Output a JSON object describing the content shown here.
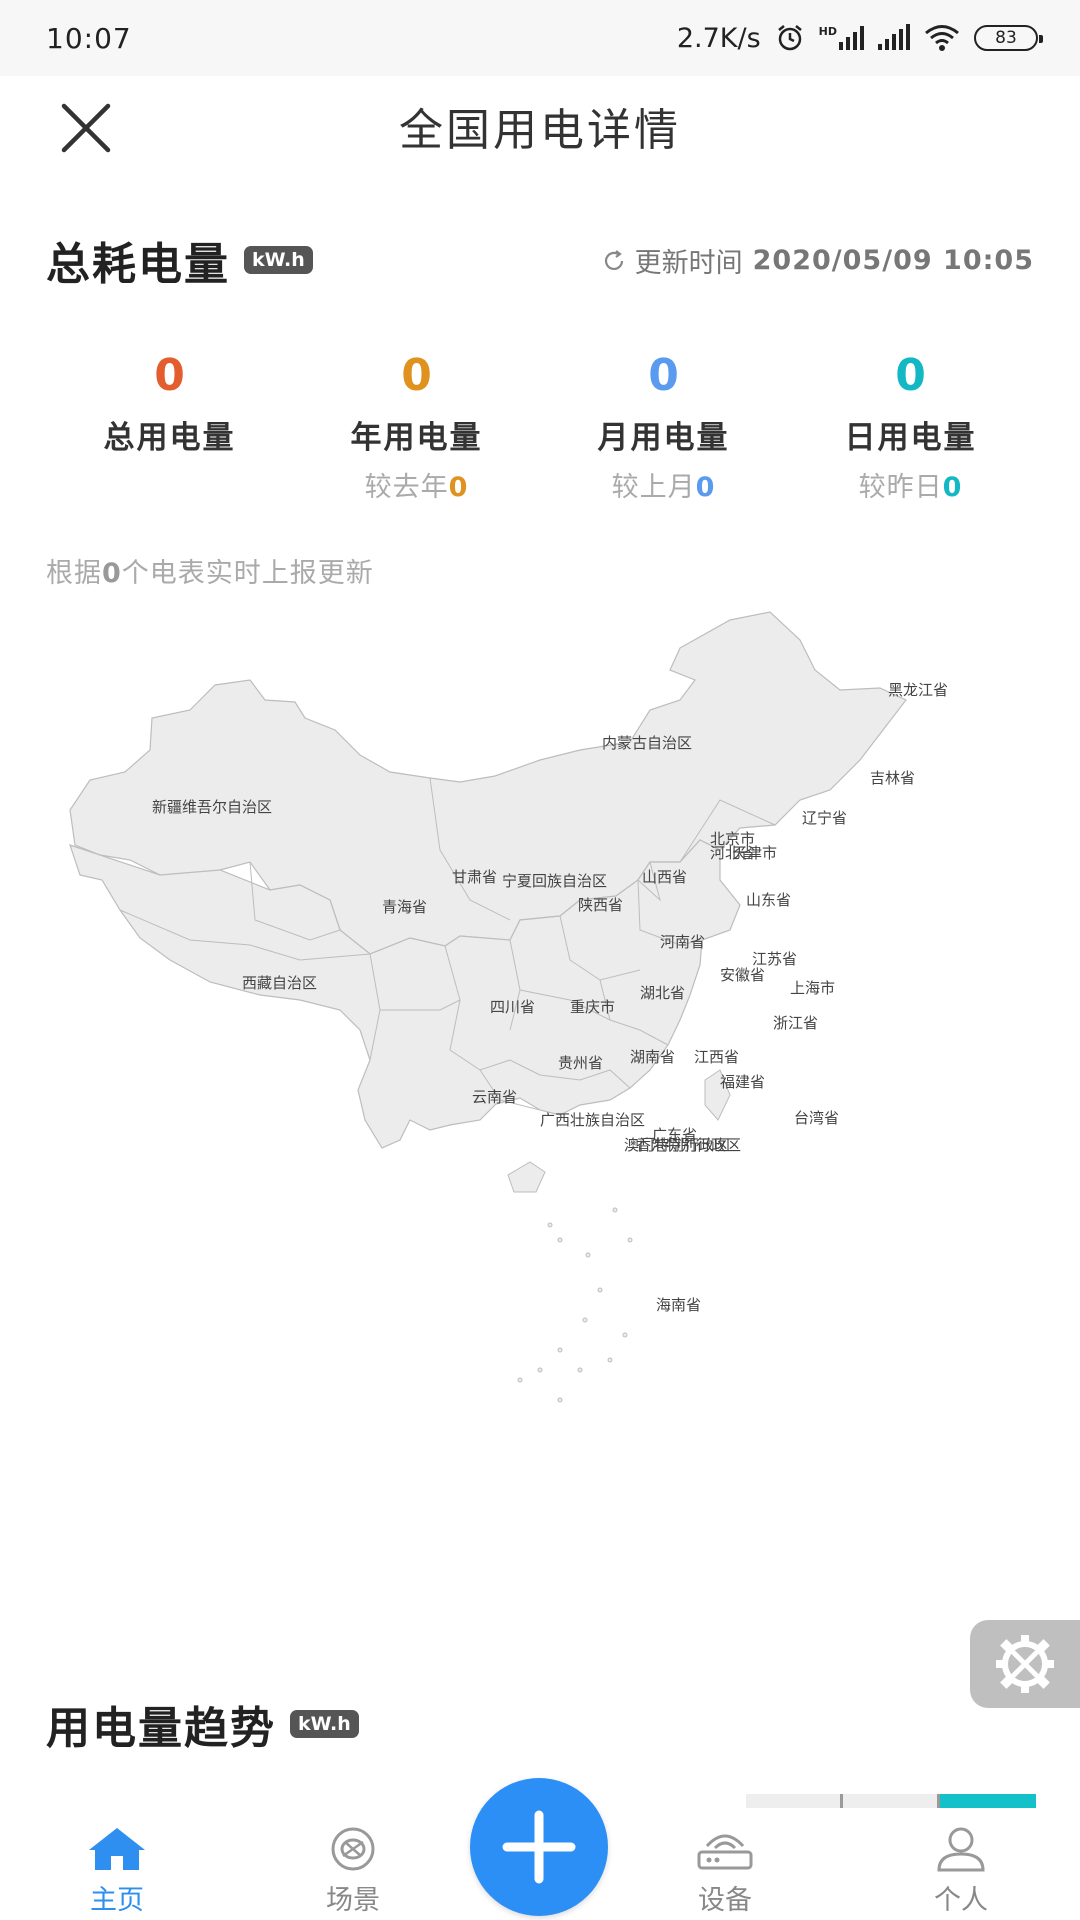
{
  "status_bar": {
    "time": "10:07",
    "network_speed": "2.7K/s",
    "hd_label": "HD",
    "battery": "83"
  },
  "header": {
    "title": "全国用电详情",
    "close_icon": "close-icon"
  },
  "consumption": {
    "title": "总耗电量",
    "unit": "kW.h",
    "update_label": "更新时间",
    "update_time": "2020/05/09 10:05",
    "stats": [
      {
        "value": "0",
        "label": "总用电量",
        "compare_label": "",
        "compare_value": "",
        "color": "#e45d2f"
      },
      {
        "value": "0",
        "label": "年用电量",
        "compare_label": "较去年",
        "compare_value": "0",
        "color": "#e0921f"
      },
      {
        "value": "0",
        "label": "月用电量",
        "compare_label": "较上月",
        "compare_value": "0",
        "color": "#5a9bf0"
      },
      {
        "value": "0",
        "label": "日用电量",
        "compare_label": "较昨日",
        "compare_value": "0",
        "color": "#13b8c4"
      }
    ],
    "source_prefix": "根据",
    "source_count": "0",
    "source_suffix": "个电表实时上报更新"
  },
  "map": {
    "provinces": [
      {
        "name": "黑龙江省"
      },
      {
        "name": "吉林省"
      },
      {
        "name": "辽宁省"
      },
      {
        "name": "内蒙古自治区"
      },
      {
        "name": "新疆维吾尔自治区"
      },
      {
        "name": "北京市"
      },
      {
        "name": "天津市"
      },
      {
        "name": "河北省"
      },
      {
        "name": "甘肃省"
      },
      {
        "name": "宁夏回族自治区"
      },
      {
        "name": "山西省"
      },
      {
        "name": "青海省"
      },
      {
        "name": "陕西省"
      },
      {
        "name": "山东省"
      },
      {
        "name": "河南省"
      },
      {
        "name": "江苏省"
      },
      {
        "name": "西藏自治区"
      },
      {
        "name": "安徽省"
      },
      {
        "name": "上海市"
      },
      {
        "name": "湖北省"
      },
      {
        "name": "四川省"
      },
      {
        "name": "重庆市"
      },
      {
        "name": "浙江省"
      },
      {
        "name": "湖南省"
      },
      {
        "name": "江西省"
      },
      {
        "name": "贵州省"
      },
      {
        "name": "福建省"
      },
      {
        "name": "云南省"
      },
      {
        "name": "广西壮族自治区"
      },
      {
        "name": "台湾省"
      },
      {
        "name": "广东省"
      },
      {
        "name": "香港特别行政区"
      },
      {
        "name": "澳门特别行政区"
      },
      {
        "name": "海南省"
      }
    ]
  },
  "trend": {
    "title": "用电量趋势",
    "unit": "kW.h"
  },
  "nav": {
    "home": "主页",
    "scene": "场景",
    "device": "设备",
    "profile": "个人"
  },
  "colors": {
    "accent": "#2c8ff5",
    "trend_active": "#15c1c9"
  }
}
